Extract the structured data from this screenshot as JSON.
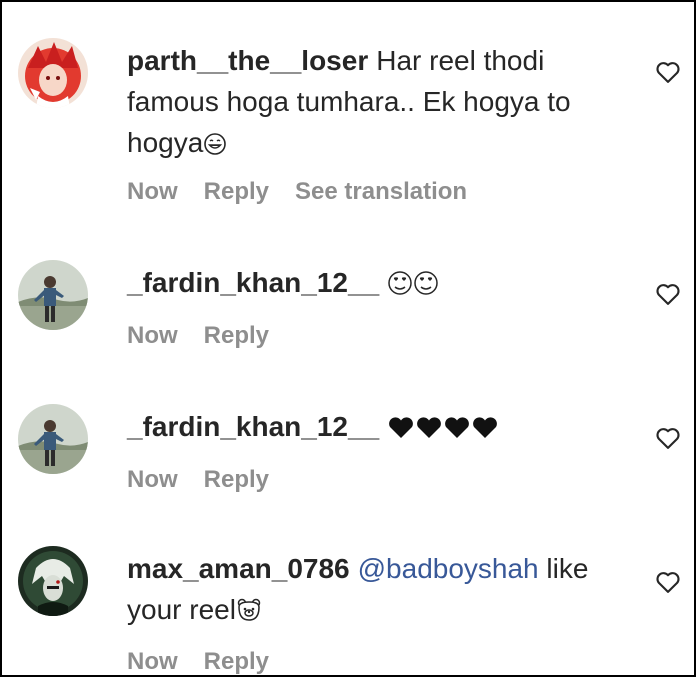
{
  "comments": [
    {
      "username": "parth__the__loser",
      "text": "Har reel thodi famous hoga tumhara.. Ek hogya to hogya",
      "emoji": "smiling-face-icon",
      "actions": {
        "time": "Now",
        "reply": "Reply",
        "translate": "See translation"
      }
    },
    {
      "username": "_fardin_khan_12__",
      "text": "",
      "emoji": "heart-eyes-face-icon",
      "actions": {
        "time": "Now",
        "reply": "Reply"
      }
    },
    {
      "username": "_fardin_khan_12__",
      "text": "",
      "emoji": "black-heart-icon",
      "actions": {
        "time": "Now",
        "reply": "Reply"
      }
    },
    {
      "username": "max_aman_0786",
      "mention": "@badboyshah",
      "text": "like your reel",
      "emoji": "bear-face-icon",
      "actions": {
        "time": "Now",
        "reply": "Reply"
      }
    }
  ],
  "colors": {
    "text": "#262626",
    "muted": "#8e8e8e",
    "mention": "#385898"
  }
}
